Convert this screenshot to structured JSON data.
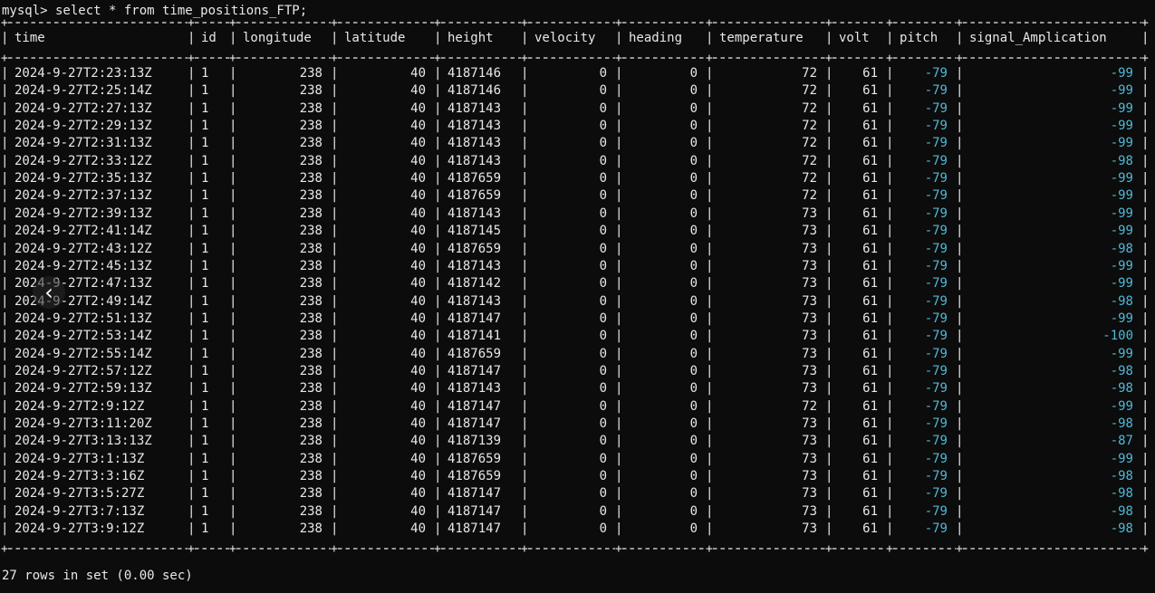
{
  "command_line": "mysql> select * from time_positions_FTP;",
  "columns": [
    "time",
    "id",
    "longitude",
    "latitude",
    "height",
    "velocity",
    "heading",
    "temperature",
    "volt",
    "pitch",
    "signal_Amplication"
  ],
  "rows": [
    [
      "2024-9-27T2:23:13Z",
      "1",
      "238",
      "40",
      "4187146",
      "0",
      "0",
      "72",
      "61",
      "-79",
      "-99"
    ],
    [
      "2024-9-27T2:25:14Z",
      "1",
      "238",
      "40",
      "4187146",
      "0",
      "0",
      "72",
      "61",
      "-79",
      "-99"
    ],
    [
      "2024-9-27T2:27:13Z",
      "1",
      "238",
      "40",
      "4187143",
      "0",
      "0",
      "72",
      "61",
      "-79",
      "-99"
    ],
    [
      "2024-9-27T2:29:13Z",
      "1",
      "238",
      "40",
      "4187143",
      "0",
      "0",
      "72",
      "61",
      "-79",
      "-99"
    ],
    [
      "2024-9-27T2:31:13Z",
      "1",
      "238",
      "40",
      "4187143",
      "0",
      "0",
      "72",
      "61",
      "-79",
      "-99"
    ],
    [
      "2024-9-27T2:33:12Z",
      "1",
      "238",
      "40",
      "4187143",
      "0",
      "0",
      "72",
      "61",
      "-79",
      "-98"
    ],
    [
      "2024-9-27T2:35:13Z",
      "1",
      "238",
      "40",
      "4187659",
      "0",
      "0",
      "72",
      "61",
      "-79",
      "-99"
    ],
    [
      "2024-9-27T2:37:13Z",
      "1",
      "238",
      "40",
      "4187659",
      "0",
      "0",
      "72",
      "61",
      "-79",
      "-99"
    ],
    [
      "2024-9-27T2:39:13Z",
      "1",
      "238",
      "40",
      "4187143",
      "0",
      "0",
      "73",
      "61",
      "-79",
      "-99"
    ],
    [
      "2024-9-27T2:41:14Z",
      "1",
      "238",
      "40",
      "4187145",
      "0",
      "0",
      "73",
      "61",
      "-79",
      "-99"
    ],
    [
      "2024-9-27T2:43:12Z",
      "1",
      "238",
      "40",
      "4187659",
      "0",
      "0",
      "73",
      "61",
      "-79",
      "-98"
    ],
    [
      "2024-9-27T2:45:13Z",
      "1",
      "238",
      "40",
      "4187143",
      "0",
      "0",
      "73",
      "61",
      "-79",
      "-99"
    ],
    [
      "2024-9-27T2:47:13Z",
      "1",
      "238",
      "40",
      "4187142",
      "0",
      "0",
      "73",
      "61",
      "-79",
      "-99"
    ],
    [
      "2024-9-27T2:49:14Z",
      "1",
      "238",
      "40",
      "4187143",
      "0",
      "0",
      "73",
      "61",
      "-79",
      "-98"
    ],
    [
      "2024-9-27T2:51:13Z",
      "1",
      "238",
      "40",
      "4187147",
      "0",
      "0",
      "73",
      "61",
      "-79",
      "-99"
    ],
    [
      "2024-9-27T2:53:14Z",
      "1",
      "238",
      "40",
      "4187141",
      "0",
      "0",
      "73",
      "61",
      "-79",
      "-100"
    ],
    [
      "2024-9-27T2:55:14Z",
      "1",
      "238",
      "40",
      "4187659",
      "0",
      "0",
      "73",
      "61",
      "-79",
      "-99"
    ],
    [
      "2024-9-27T2:57:12Z",
      "1",
      "238",
      "40",
      "4187147",
      "0",
      "0",
      "73",
      "61",
      "-79",
      "-98"
    ],
    [
      "2024-9-27T2:59:13Z",
      "1",
      "238",
      "40",
      "4187143",
      "0",
      "0",
      "73",
      "61",
      "-79",
      "-98"
    ],
    [
      "2024-9-27T2:9:12Z",
      "1",
      "238",
      "40",
      "4187147",
      "0",
      "0",
      "72",
      "61",
      "-79",
      "-99"
    ],
    [
      "2024-9-27T3:11:20Z",
      "1",
      "238",
      "40",
      "4187147",
      "0",
      "0",
      "73",
      "61",
      "-79",
      "-98"
    ],
    [
      "2024-9-27T3:13:13Z",
      "1",
      "238",
      "40",
      "4187139",
      "0",
      "0",
      "73",
      "61",
      "-79",
      "-87"
    ],
    [
      "2024-9-27T3:1:13Z",
      "1",
      "238",
      "40",
      "4187659",
      "0",
      "0",
      "73",
      "61",
      "-79",
      "-99"
    ],
    [
      "2024-9-27T3:3:16Z",
      "1",
      "238",
      "40",
      "4187659",
      "0",
      "0",
      "73",
      "61",
      "-79",
      "-98"
    ],
    [
      "2024-9-27T3:5:27Z",
      "1",
      "238",
      "40",
      "4187147",
      "0",
      "0",
      "73",
      "61",
      "-79",
      "-98"
    ],
    [
      "2024-9-27T3:7:13Z",
      "1",
      "238",
      "40",
      "4187147",
      "0",
      "0",
      "73",
      "61",
      "-79",
      "-98"
    ],
    [
      "2024-9-27T3:9:12Z",
      "1",
      "238",
      "40",
      "4187147",
      "0",
      "0",
      "73",
      "61",
      "-79",
      "-98"
    ]
  ],
  "result_line": "27 rows in set (0.00 sec)",
  "nav_arrow_glyph": "‹",
  "nav_arrow_icon": "chevron-left-icon",
  "negative_color": "#4fb8d6"
}
